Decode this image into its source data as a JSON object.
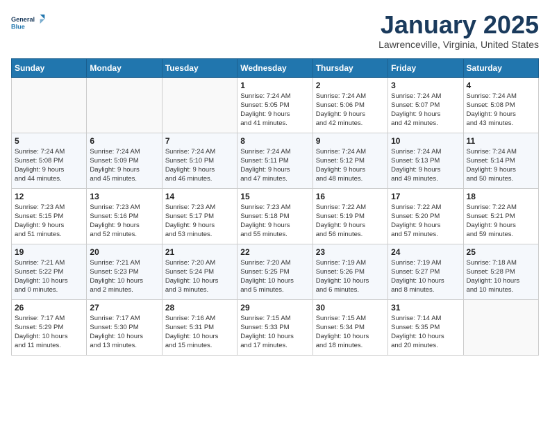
{
  "logo": {
    "line1": "General",
    "line2": "Blue"
  },
  "title": "January 2025",
  "location": "Lawrenceville, Virginia, United States",
  "days_of_week": [
    "Sunday",
    "Monday",
    "Tuesday",
    "Wednesday",
    "Thursday",
    "Friday",
    "Saturday"
  ],
  "weeks": [
    [
      {
        "day": "",
        "info": ""
      },
      {
        "day": "",
        "info": ""
      },
      {
        "day": "",
        "info": ""
      },
      {
        "day": "1",
        "info": "Sunrise: 7:24 AM\nSunset: 5:05 PM\nDaylight: 9 hours\nand 41 minutes."
      },
      {
        "day": "2",
        "info": "Sunrise: 7:24 AM\nSunset: 5:06 PM\nDaylight: 9 hours\nand 42 minutes."
      },
      {
        "day": "3",
        "info": "Sunrise: 7:24 AM\nSunset: 5:07 PM\nDaylight: 9 hours\nand 42 minutes."
      },
      {
        "day": "4",
        "info": "Sunrise: 7:24 AM\nSunset: 5:08 PM\nDaylight: 9 hours\nand 43 minutes."
      }
    ],
    [
      {
        "day": "5",
        "info": "Sunrise: 7:24 AM\nSunset: 5:08 PM\nDaylight: 9 hours\nand 44 minutes."
      },
      {
        "day": "6",
        "info": "Sunrise: 7:24 AM\nSunset: 5:09 PM\nDaylight: 9 hours\nand 45 minutes."
      },
      {
        "day": "7",
        "info": "Sunrise: 7:24 AM\nSunset: 5:10 PM\nDaylight: 9 hours\nand 46 minutes."
      },
      {
        "day": "8",
        "info": "Sunrise: 7:24 AM\nSunset: 5:11 PM\nDaylight: 9 hours\nand 47 minutes."
      },
      {
        "day": "9",
        "info": "Sunrise: 7:24 AM\nSunset: 5:12 PM\nDaylight: 9 hours\nand 48 minutes."
      },
      {
        "day": "10",
        "info": "Sunrise: 7:24 AM\nSunset: 5:13 PM\nDaylight: 9 hours\nand 49 minutes."
      },
      {
        "day": "11",
        "info": "Sunrise: 7:24 AM\nSunset: 5:14 PM\nDaylight: 9 hours\nand 50 minutes."
      }
    ],
    [
      {
        "day": "12",
        "info": "Sunrise: 7:23 AM\nSunset: 5:15 PM\nDaylight: 9 hours\nand 51 minutes."
      },
      {
        "day": "13",
        "info": "Sunrise: 7:23 AM\nSunset: 5:16 PM\nDaylight: 9 hours\nand 52 minutes."
      },
      {
        "day": "14",
        "info": "Sunrise: 7:23 AM\nSunset: 5:17 PM\nDaylight: 9 hours\nand 53 minutes."
      },
      {
        "day": "15",
        "info": "Sunrise: 7:23 AM\nSunset: 5:18 PM\nDaylight: 9 hours\nand 55 minutes."
      },
      {
        "day": "16",
        "info": "Sunrise: 7:22 AM\nSunset: 5:19 PM\nDaylight: 9 hours\nand 56 minutes."
      },
      {
        "day": "17",
        "info": "Sunrise: 7:22 AM\nSunset: 5:20 PM\nDaylight: 9 hours\nand 57 minutes."
      },
      {
        "day": "18",
        "info": "Sunrise: 7:22 AM\nSunset: 5:21 PM\nDaylight: 9 hours\nand 59 minutes."
      }
    ],
    [
      {
        "day": "19",
        "info": "Sunrise: 7:21 AM\nSunset: 5:22 PM\nDaylight: 10 hours\nand 0 minutes."
      },
      {
        "day": "20",
        "info": "Sunrise: 7:21 AM\nSunset: 5:23 PM\nDaylight: 10 hours\nand 2 minutes."
      },
      {
        "day": "21",
        "info": "Sunrise: 7:20 AM\nSunset: 5:24 PM\nDaylight: 10 hours\nand 3 minutes."
      },
      {
        "day": "22",
        "info": "Sunrise: 7:20 AM\nSunset: 5:25 PM\nDaylight: 10 hours\nand 5 minutes."
      },
      {
        "day": "23",
        "info": "Sunrise: 7:19 AM\nSunset: 5:26 PM\nDaylight: 10 hours\nand 6 minutes."
      },
      {
        "day": "24",
        "info": "Sunrise: 7:19 AM\nSunset: 5:27 PM\nDaylight: 10 hours\nand 8 minutes."
      },
      {
        "day": "25",
        "info": "Sunrise: 7:18 AM\nSunset: 5:28 PM\nDaylight: 10 hours\nand 10 minutes."
      }
    ],
    [
      {
        "day": "26",
        "info": "Sunrise: 7:17 AM\nSunset: 5:29 PM\nDaylight: 10 hours\nand 11 minutes."
      },
      {
        "day": "27",
        "info": "Sunrise: 7:17 AM\nSunset: 5:30 PM\nDaylight: 10 hours\nand 13 minutes."
      },
      {
        "day": "28",
        "info": "Sunrise: 7:16 AM\nSunset: 5:31 PM\nDaylight: 10 hours\nand 15 minutes."
      },
      {
        "day": "29",
        "info": "Sunrise: 7:15 AM\nSunset: 5:33 PM\nDaylight: 10 hours\nand 17 minutes."
      },
      {
        "day": "30",
        "info": "Sunrise: 7:15 AM\nSunset: 5:34 PM\nDaylight: 10 hours\nand 18 minutes."
      },
      {
        "day": "31",
        "info": "Sunrise: 7:14 AM\nSunset: 5:35 PM\nDaylight: 10 hours\nand 20 minutes."
      },
      {
        "day": "",
        "info": ""
      }
    ]
  ]
}
